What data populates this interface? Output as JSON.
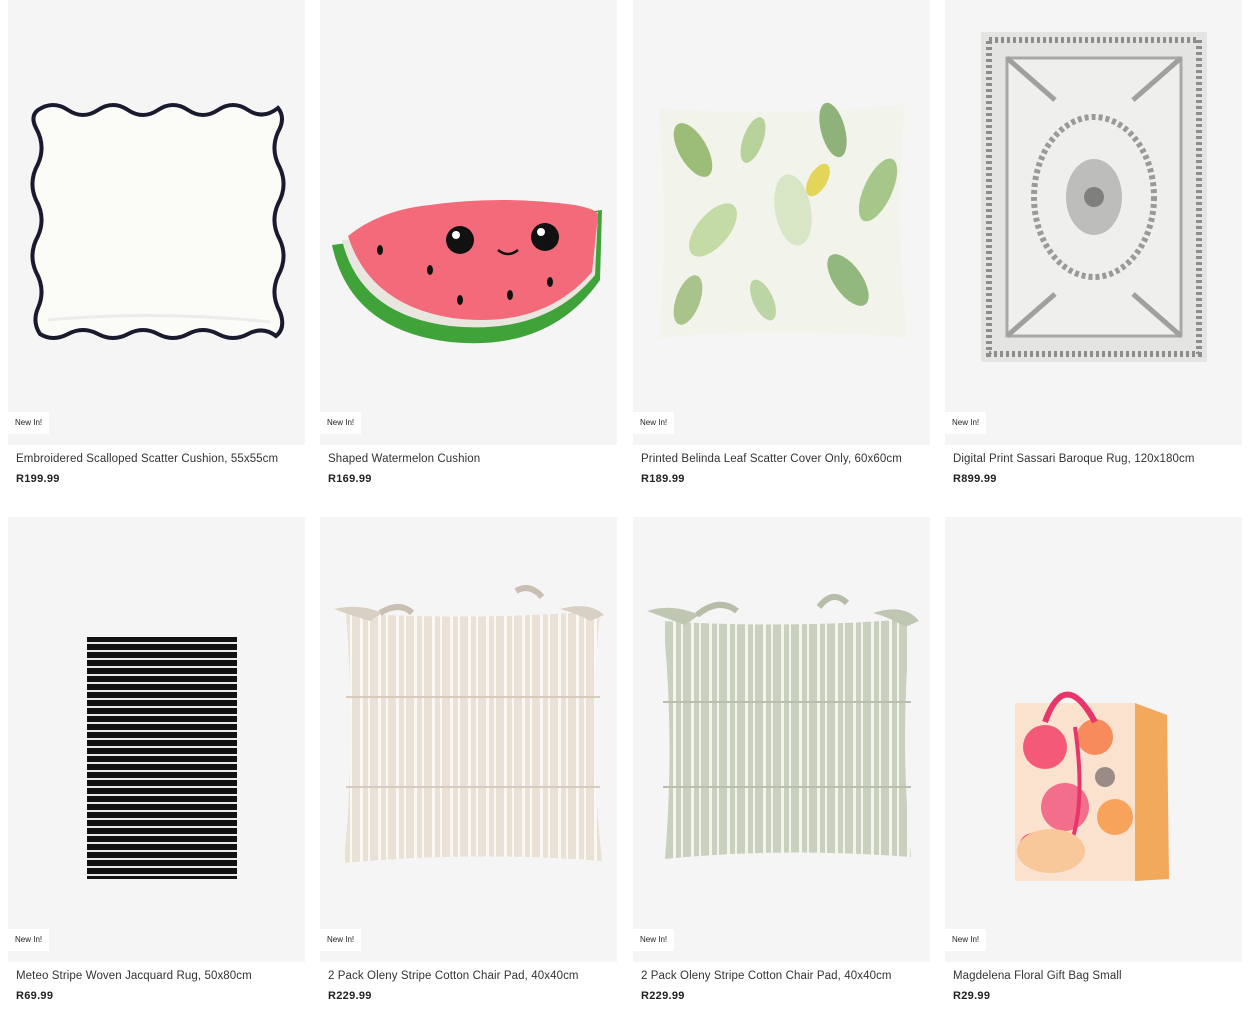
{
  "products": [
    {
      "badge": "New In!",
      "title": "Embroidered Scalloped Scatter Cushion, 55x55cm",
      "price": "R199.99",
      "image_icon": "scalloped-cushion-image"
    },
    {
      "badge": "New In!",
      "title": "Shaped Watermelon Cushion",
      "price": "R169.99",
      "image_icon": "watermelon-cushion-image"
    },
    {
      "badge": "New In!",
      "title": "Printed Belinda Leaf Scatter Cover Only, 60x60cm",
      "price": "R189.99",
      "image_icon": "leaf-cushion-image"
    },
    {
      "badge": "New In!",
      "title": "Digital Print Sassari Baroque Rug, 120x180cm",
      "price": "R899.99",
      "image_icon": "baroque-rug-image"
    },
    {
      "badge": "New In!",
      "title": "Meteo Stripe Woven Jacquard Rug, 50x80cm",
      "price": "R69.99",
      "image_icon": "stripe-rug-image"
    },
    {
      "badge": "New In!",
      "title": "2 Pack Oleny Stripe Cotton Chair Pad, 40x40cm",
      "price": "R229.99",
      "image_icon": "beige-chair-pad-image"
    },
    {
      "badge": "New In!",
      "title": "2 Pack Oleny Stripe Cotton Chair Pad, 40x40cm",
      "price": "R229.99",
      "image_icon": "sage-chair-pad-image"
    },
    {
      "badge": "New In!",
      "title": "Magdelena Floral Gift Bag Small",
      "price": "R29.99",
      "image_icon": "floral-gift-bag-image"
    }
  ]
}
